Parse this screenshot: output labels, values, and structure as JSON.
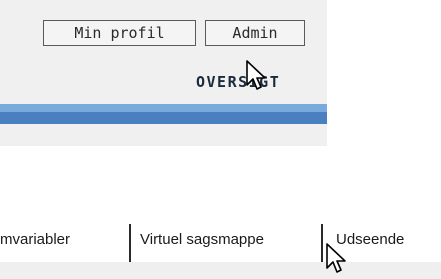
{
  "header": {
    "buttons": [
      {
        "label": "Min profil"
      },
      {
        "label": "Admin"
      }
    ],
    "section_title": "OVERSIGT"
  },
  "tabs": [
    {
      "label": "mvariabler"
    },
    {
      "label": "Virtuel sagsmappe"
    },
    {
      "label": "Udseende"
    }
  ],
  "colors": {
    "bar_light": "#7aa9dc",
    "bar_dark": "#4a7fc0"
  }
}
